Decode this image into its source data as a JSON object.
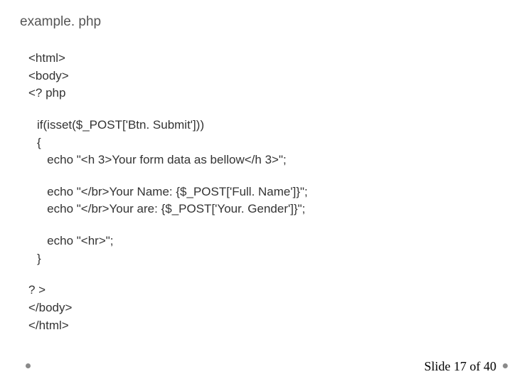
{
  "title": "example. php",
  "code1": {
    "l1": "<html>",
    "l2": "<body>",
    "l3": "<? php"
  },
  "code2": {
    "l1": "if(isset($_POST['Btn. Submit']))",
    "l2": "{",
    "l3": "   echo \"<h 3>Your form data as bellow</h 3>\";",
    "l4": "   echo \"</br>Your Name: {$_POST['Full. Name']}\";",
    "l5": "   echo \"</br>Your are: {$_POST['Your. Gender']}\";",
    "l6": "   echo \"<hr>\";",
    "l7": "}"
  },
  "code3": {
    "l1": "? >",
    "l2": "</body>",
    "l3": "</html>"
  },
  "footer": "Slide 17 of 40"
}
